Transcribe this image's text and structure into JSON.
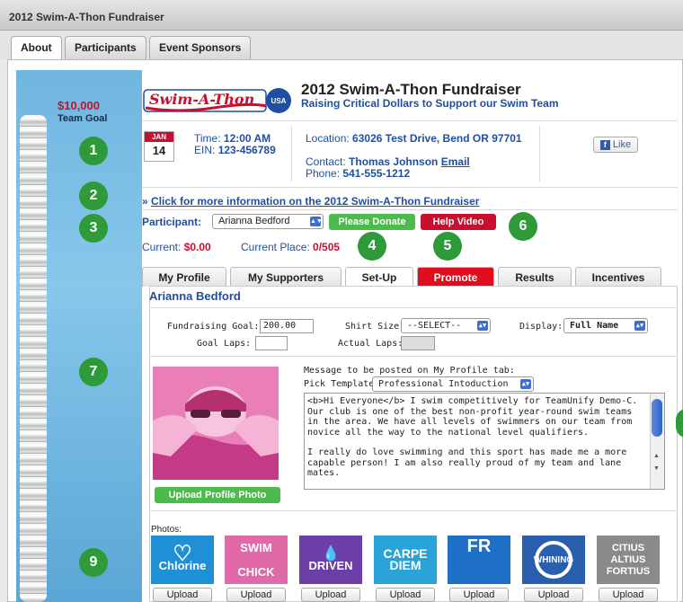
{
  "window": {
    "title": "2012 Swim-A-Thon Fundraiser"
  },
  "top_tabs": [
    {
      "label": "About",
      "active": true
    },
    {
      "label": "Participants",
      "active": false
    },
    {
      "label": "Event Sponsors",
      "active": false
    }
  ],
  "sidebar": {
    "goal_amount": "$10,000",
    "goal_label": "Team Goal"
  },
  "markers": [
    "1",
    "2",
    "3",
    "4",
    "5",
    "6",
    "7",
    "9"
  ],
  "header": {
    "logo_text": "Swim-A-Thon",
    "logo_badge": "USA",
    "title": "2012 Swim-A-Thon Fundraiser",
    "subtitle": "Raising Critical Dollars to Support our Swim Team"
  },
  "event": {
    "cal_month": "JAN",
    "cal_day": "14",
    "time_label": "Time:",
    "time_value": "12:00 AM",
    "ein_label": "EIN:",
    "ein_value": "123-456789",
    "location_label": "Location:",
    "location_value": "63026 Test Drive, Bend OR 97701",
    "contact_label": "Contact:",
    "contact_value": "Thomas Johnson",
    "email_link": "Email",
    "phone_label": "Phone:",
    "phone_value": "541-555-1212",
    "like_label": "Like"
  },
  "more_info": {
    "prefix": "»",
    "link": "Click for more information on the 2012 Swim-A-Thon Fundraiser"
  },
  "participant": {
    "label": "Participant:",
    "selected": "Arianna Bedford",
    "donate_label": "Please Donate",
    "help_label": "Help Video",
    "current_label": "Current:",
    "current_value": "$0.00",
    "place_label": "Current Place:",
    "place_value": "0/505"
  },
  "profile_tabs": [
    {
      "label": "My Profile"
    },
    {
      "label": "My Supporters"
    },
    {
      "label": "Set-Up"
    },
    {
      "label": "Promote"
    },
    {
      "label": "Results"
    },
    {
      "label": "Incentives"
    }
  ],
  "setup": {
    "name": "Arianna Bedford",
    "goal_label": "Fundraising Goal: $",
    "goal_value": "200.00",
    "shirt_label": "Shirt Size:",
    "shirt_value": "--SELECT--",
    "display_label": "Display:",
    "display_value": "Full Name",
    "goal_laps_label": "Goal Laps:",
    "goal_laps_value": "",
    "actual_laps_label": "Actual Laps:",
    "actual_laps_value": "",
    "message_label": "Message to be posted on My Profile tab:",
    "template_label": "Pick Template:",
    "template_value": "Professional Intoduction",
    "message_p1": "<b>Hi Everyone</b> I swim competitively for TeamUnify Demo-C. Our club is one of the best non-profit year-round swim teams in the area. We have all levels of swimmers on our team from novice all the way to the national level qualifiers.",
    "message_p2": "I really do love swimming and this sport has made me a more capable person! I am also really proud of my team and lane mates.",
    "upload_profile_label": "Upload Profile Photo"
  },
  "photos": {
    "label": "Photos:",
    "upload_label": "Upload",
    "items": [
      {
        "line1": "",
        "line2": "Chlorine",
        "color": "#1f8fd6"
      },
      {
        "line1": "SWIM",
        "line2": "CHICK",
        "color": "#e06aa8"
      },
      {
        "line1": "",
        "line2": "DRIVEN",
        "color": "#6c3fa8"
      },
      {
        "line1": "CARPE",
        "line2": "DIEM",
        "color": "#29a3d8"
      },
      {
        "line1": "FR",
        "line2": "",
        "color": "#1e6fc6"
      },
      {
        "line1": "WHINING",
        "line2": "",
        "color": "#2a5fae"
      },
      {
        "line1": "CITIUS ALTIUS",
        "line2": "FORTIUS",
        "color": "#8a8a8a"
      }
    ]
  }
}
